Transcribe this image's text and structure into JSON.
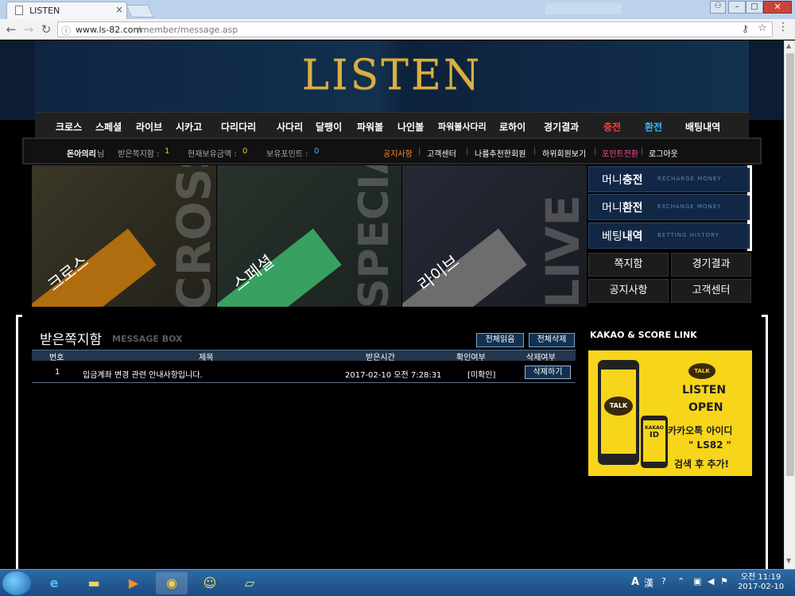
{
  "browser": {
    "tab_title": "LISTEN",
    "url_host": "www.ls-82.com",
    "url_path": "/member/message.asp"
  },
  "site": {
    "logo": "LISTEN",
    "nav": [
      {
        "label": "크로스",
        "color": "#ffffff"
      },
      {
        "label": "스페셜",
        "color": "#ffffff"
      },
      {
        "label": "라이브",
        "color": "#ffffff"
      },
      {
        "label": "시카고",
        "color": "#ffffff"
      },
      {
        "label": "다리다리",
        "color": "#ffffff"
      },
      {
        "label": "사다리",
        "color": "#ffffff"
      },
      {
        "label": "달팽이",
        "color": "#ffffff"
      },
      {
        "label": "파워볼",
        "color": "#ffffff"
      },
      {
        "label": "나인볼",
        "color": "#ffffff"
      },
      {
        "label": "파워볼사다리",
        "color": "#ffffff"
      },
      {
        "label": "로하이",
        "color": "#ffffff"
      },
      {
        "label": "경기결과",
        "color": "#ffffff"
      },
      {
        "label": "충전",
        "color": "#ff3b3b"
      },
      {
        "label": "환전",
        "color": "#37b6ff"
      },
      {
        "label": "배팅내역",
        "color": "#ffffff"
      }
    ],
    "info": {
      "username": "돈아의리",
      "username_suffix": "님",
      "received_label": "받은쪽지함 :",
      "received_count": "1",
      "money_label": "현재보유금액 :",
      "money_value": "0",
      "points_label": "보유포인트 :",
      "points_value": "0",
      "links": [
        {
          "label": "공지사항",
          "color": "#ff8a2a"
        },
        {
          "label": "고객센터",
          "color": "#ffffff"
        },
        {
          "label": "나를추천한회원",
          "color": "#ffffff"
        },
        {
          "label": "하위회원보기",
          "color": "#ffffff"
        },
        {
          "label": "포인트전환",
          "color": "#ff4f9a"
        },
        {
          "label": "로그아웃",
          "color": "#ffffff"
        }
      ],
      "separator": "|"
    },
    "tiles": [
      {
        "word": "CROSS",
        "label": "크로스",
        "band_color": "#c77b0f",
        "bg": "#2c2b1f"
      },
      {
        "word": "SPECIAL",
        "label": "스페셜",
        "band_color": "#3fb06a",
        "bg": "#1f2a24"
      },
      {
        "word": "LIVE",
        "label": "라이브",
        "band_color": "#7a7a7a",
        "bg": "#1d2029"
      }
    ],
    "side_buttons": [
      {
        "main_prefix": "머니",
        "main_bold": "충전",
        "sub": "RECHARGE MONEY"
      },
      {
        "main_prefix": "머니",
        "main_bold": "환전",
        "sub": "EXCHANGE MONEY"
      },
      {
        "main_prefix": "베팅",
        "main_bold": "내역",
        "sub": "BETTING HISTORY"
      }
    ],
    "small_buttons": [
      "쪽지함",
      "경기결과",
      "공지사항",
      "고객센터"
    ]
  },
  "message_box": {
    "title": "받은쪽지함",
    "subtitle": "MESSAGE BOX",
    "read_all": "전체읽음",
    "delete_all": "전체삭제",
    "columns": [
      "번호",
      "제목",
      "받은시간",
      "확인여부",
      "삭제여부"
    ],
    "rows": [
      {
        "no": "1",
        "subject": "입금계좌 변경 관련 안내사항입니다.",
        "received": "2017-02-10 오전 7:28:31",
        "status": "[미확인]",
        "delete_label": "삭제하기"
      }
    ]
  },
  "kakao": {
    "title": "KAKAO & SCORE LINK",
    "talk": "TALK",
    "phone_text": "KAKAO",
    "phone_id": "ID",
    "line1": "LISTEN",
    "line2": "OPEN",
    "line3": "카카오톡 아이디",
    "line4": "\" LS82 \"",
    "line5": "검색 후 추가!"
  },
  "taskbar": {
    "lang_a": "A",
    "lang_hanja": "漢",
    "time": "오전 11:19",
    "date": "2017-02-10"
  }
}
